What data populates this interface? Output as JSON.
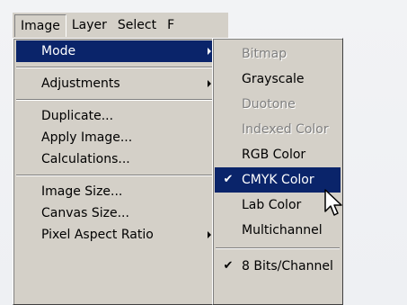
{
  "menubar": {
    "items": [
      {
        "label": "Image"
      },
      {
        "label": "Layer"
      },
      {
        "label": "Select"
      },
      {
        "label": "F"
      }
    ]
  },
  "image_menu": {
    "items": [
      {
        "label": "Mode",
        "submenu": true,
        "highlighted": true
      },
      {
        "label": "Adjustments",
        "submenu": true
      },
      {
        "label": "Duplicate..."
      },
      {
        "label": "Apply Image..."
      },
      {
        "label": "Calculations..."
      },
      {
        "label": "Image Size..."
      },
      {
        "label": "Canvas Size..."
      },
      {
        "label": "Pixel Aspect Ratio",
        "submenu": true
      }
    ]
  },
  "mode_submenu": {
    "items": [
      {
        "label": "Bitmap",
        "enabled": false
      },
      {
        "label": "Grayscale",
        "enabled": true
      },
      {
        "label": "Duotone",
        "enabled": false
      },
      {
        "label": "Indexed Color",
        "enabled": false
      },
      {
        "label": "RGB Color",
        "enabled": true
      },
      {
        "label": "CMYK Color",
        "enabled": true,
        "checked": true,
        "highlighted": true
      },
      {
        "label": "Lab Color",
        "enabled": true
      },
      {
        "label": "Multichannel",
        "enabled": true
      },
      {
        "label": "8 Bits/Channel",
        "enabled": true,
        "checked": true
      }
    ]
  },
  "colors": {
    "menu_bg": "#d4d0c8",
    "highlight": "#0a246a",
    "disabled_text": "#808080"
  },
  "icons": {
    "check": "✔",
    "cursor": "arrow-cursor-icon"
  }
}
